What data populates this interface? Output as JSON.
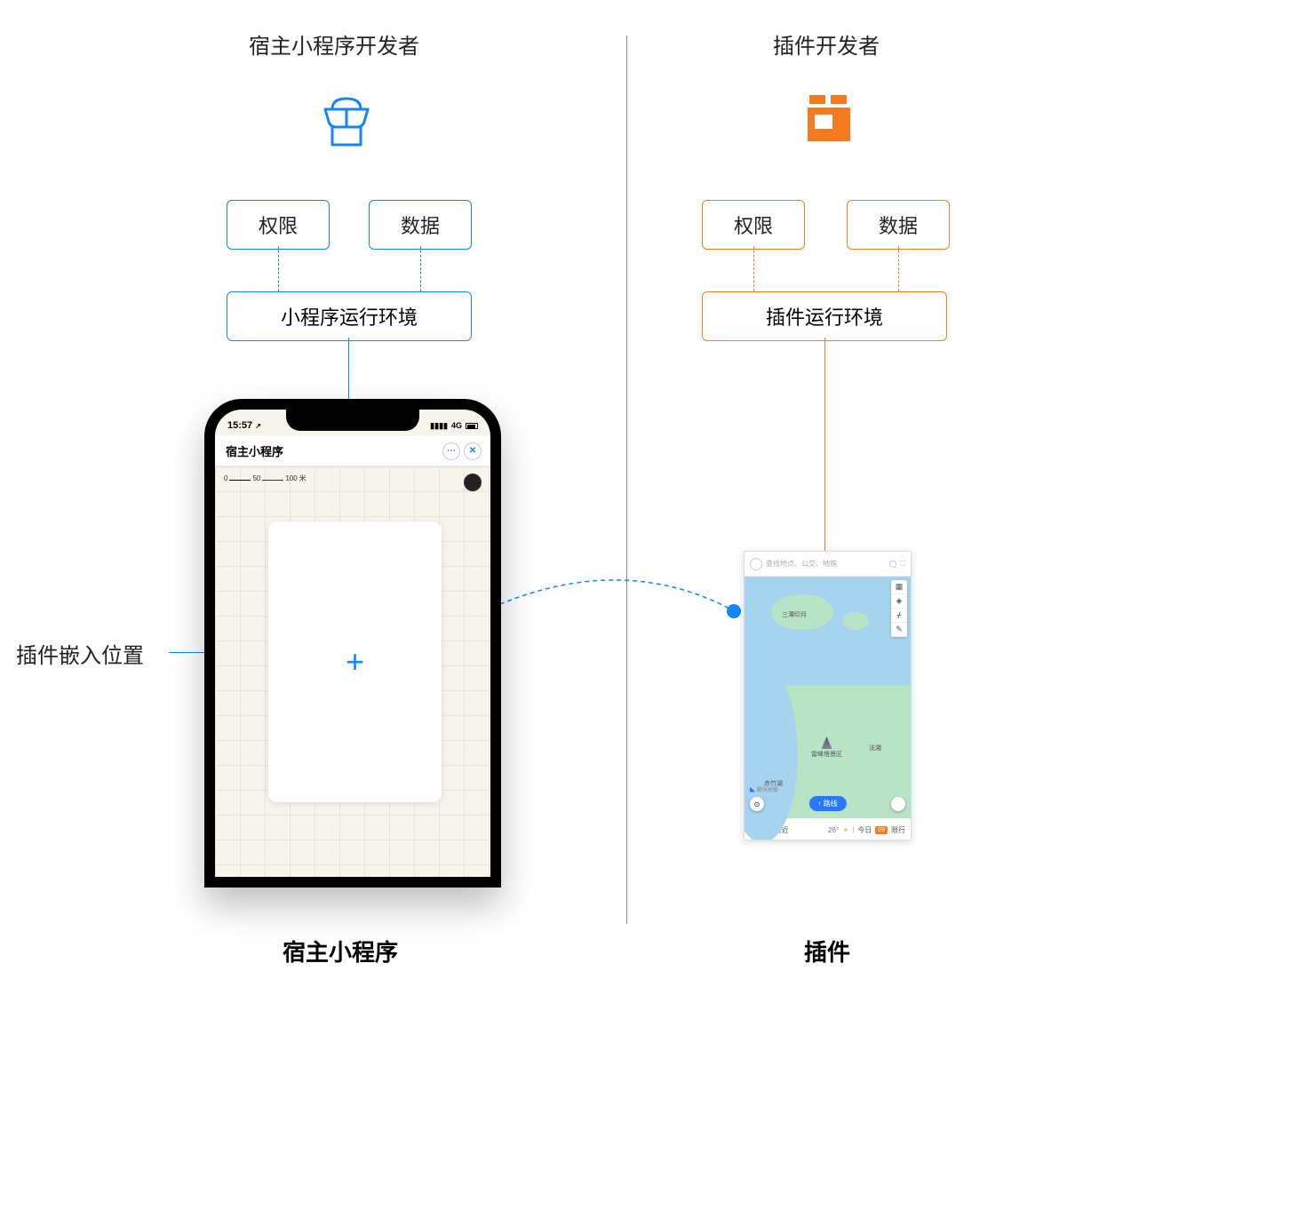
{
  "left": {
    "title": "宿主小程序开发者",
    "tags": {
      "permission": "权限",
      "data": "数据"
    },
    "env": "小程序运行环境",
    "footer": "宿主小程序"
  },
  "right": {
    "title": "插件开发者",
    "tags": {
      "permission": "权限",
      "data": "数据"
    },
    "env": "插件运行环境",
    "footer": "插件"
  },
  "embed_label": "插件嵌入位置",
  "phone": {
    "time": "15:57",
    "signal": "4G",
    "nav_title": "宿主小程序",
    "scale": {
      "a": "0",
      "b": "50",
      "c": "100",
      "unit": "米"
    }
  },
  "plugin": {
    "search_placeholder": "查找地点、公交、地铁",
    "poi_pagoda": "雷峰塔景区",
    "poi_fa": "法湘",
    "poi_san": "三潭印月",
    "poi_ztu": "赤竹湖",
    "attribution": "腾讯地图",
    "route_btn": "路线",
    "explore": "探索附近",
    "weather": "26°",
    "today": "今日",
    "limit": "限行"
  }
}
